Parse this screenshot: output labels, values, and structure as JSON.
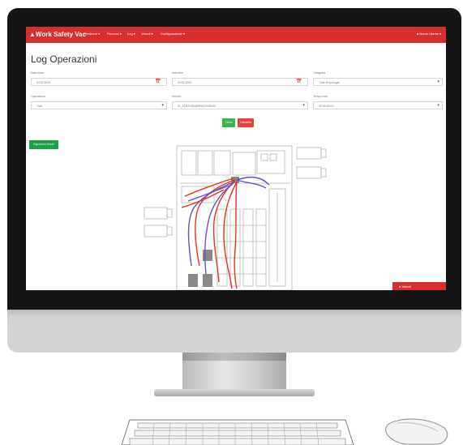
{
  "app": {
    "brand": "Work Safety Vac",
    "nav": [
      "Gestione ▾",
      "Percorsi ▾",
      "Log ▾",
      "Veicoli ▾",
      "Configurazione ▾"
    ],
    "user": "Nome Utente ▾"
  },
  "page": {
    "title": "Log Operazioni"
  },
  "form": {
    "date_from": {
      "label": "Data inizio",
      "value": "01/01/2021"
    },
    "date_to": {
      "label": "Data fine",
      "value": "31/01/2021"
    },
    "category": {
      "label": "Categoria",
      "value": "Tutte le tipologie"
    },
    "operation": {
      "label": "Operazione",
      "value": "Tutti"
    },
    "vehicle": {
      "label": "Veicolo",
      "value": "ID_A1B2C3D4E5F6G7H8I9J0"
    },
    "max_time": {
      "label": "Tempo max",
      "value": "00:00:00:00"
    }
  },
  "buttons": {
    "search": "Cerca",
    "reset": "Cancella",
    "export": "Esporta in Excel"
  },
  "bottom_tab": {
    "label": "Veicoli"
  },
  "colors": {
    "navbar": "#d62f2f",
    "success": "#38b448",
    "danger": "#e0463c",
    "track_red": "#e8321e",
    "track_purple": "#6a4fc0"
  }
}
